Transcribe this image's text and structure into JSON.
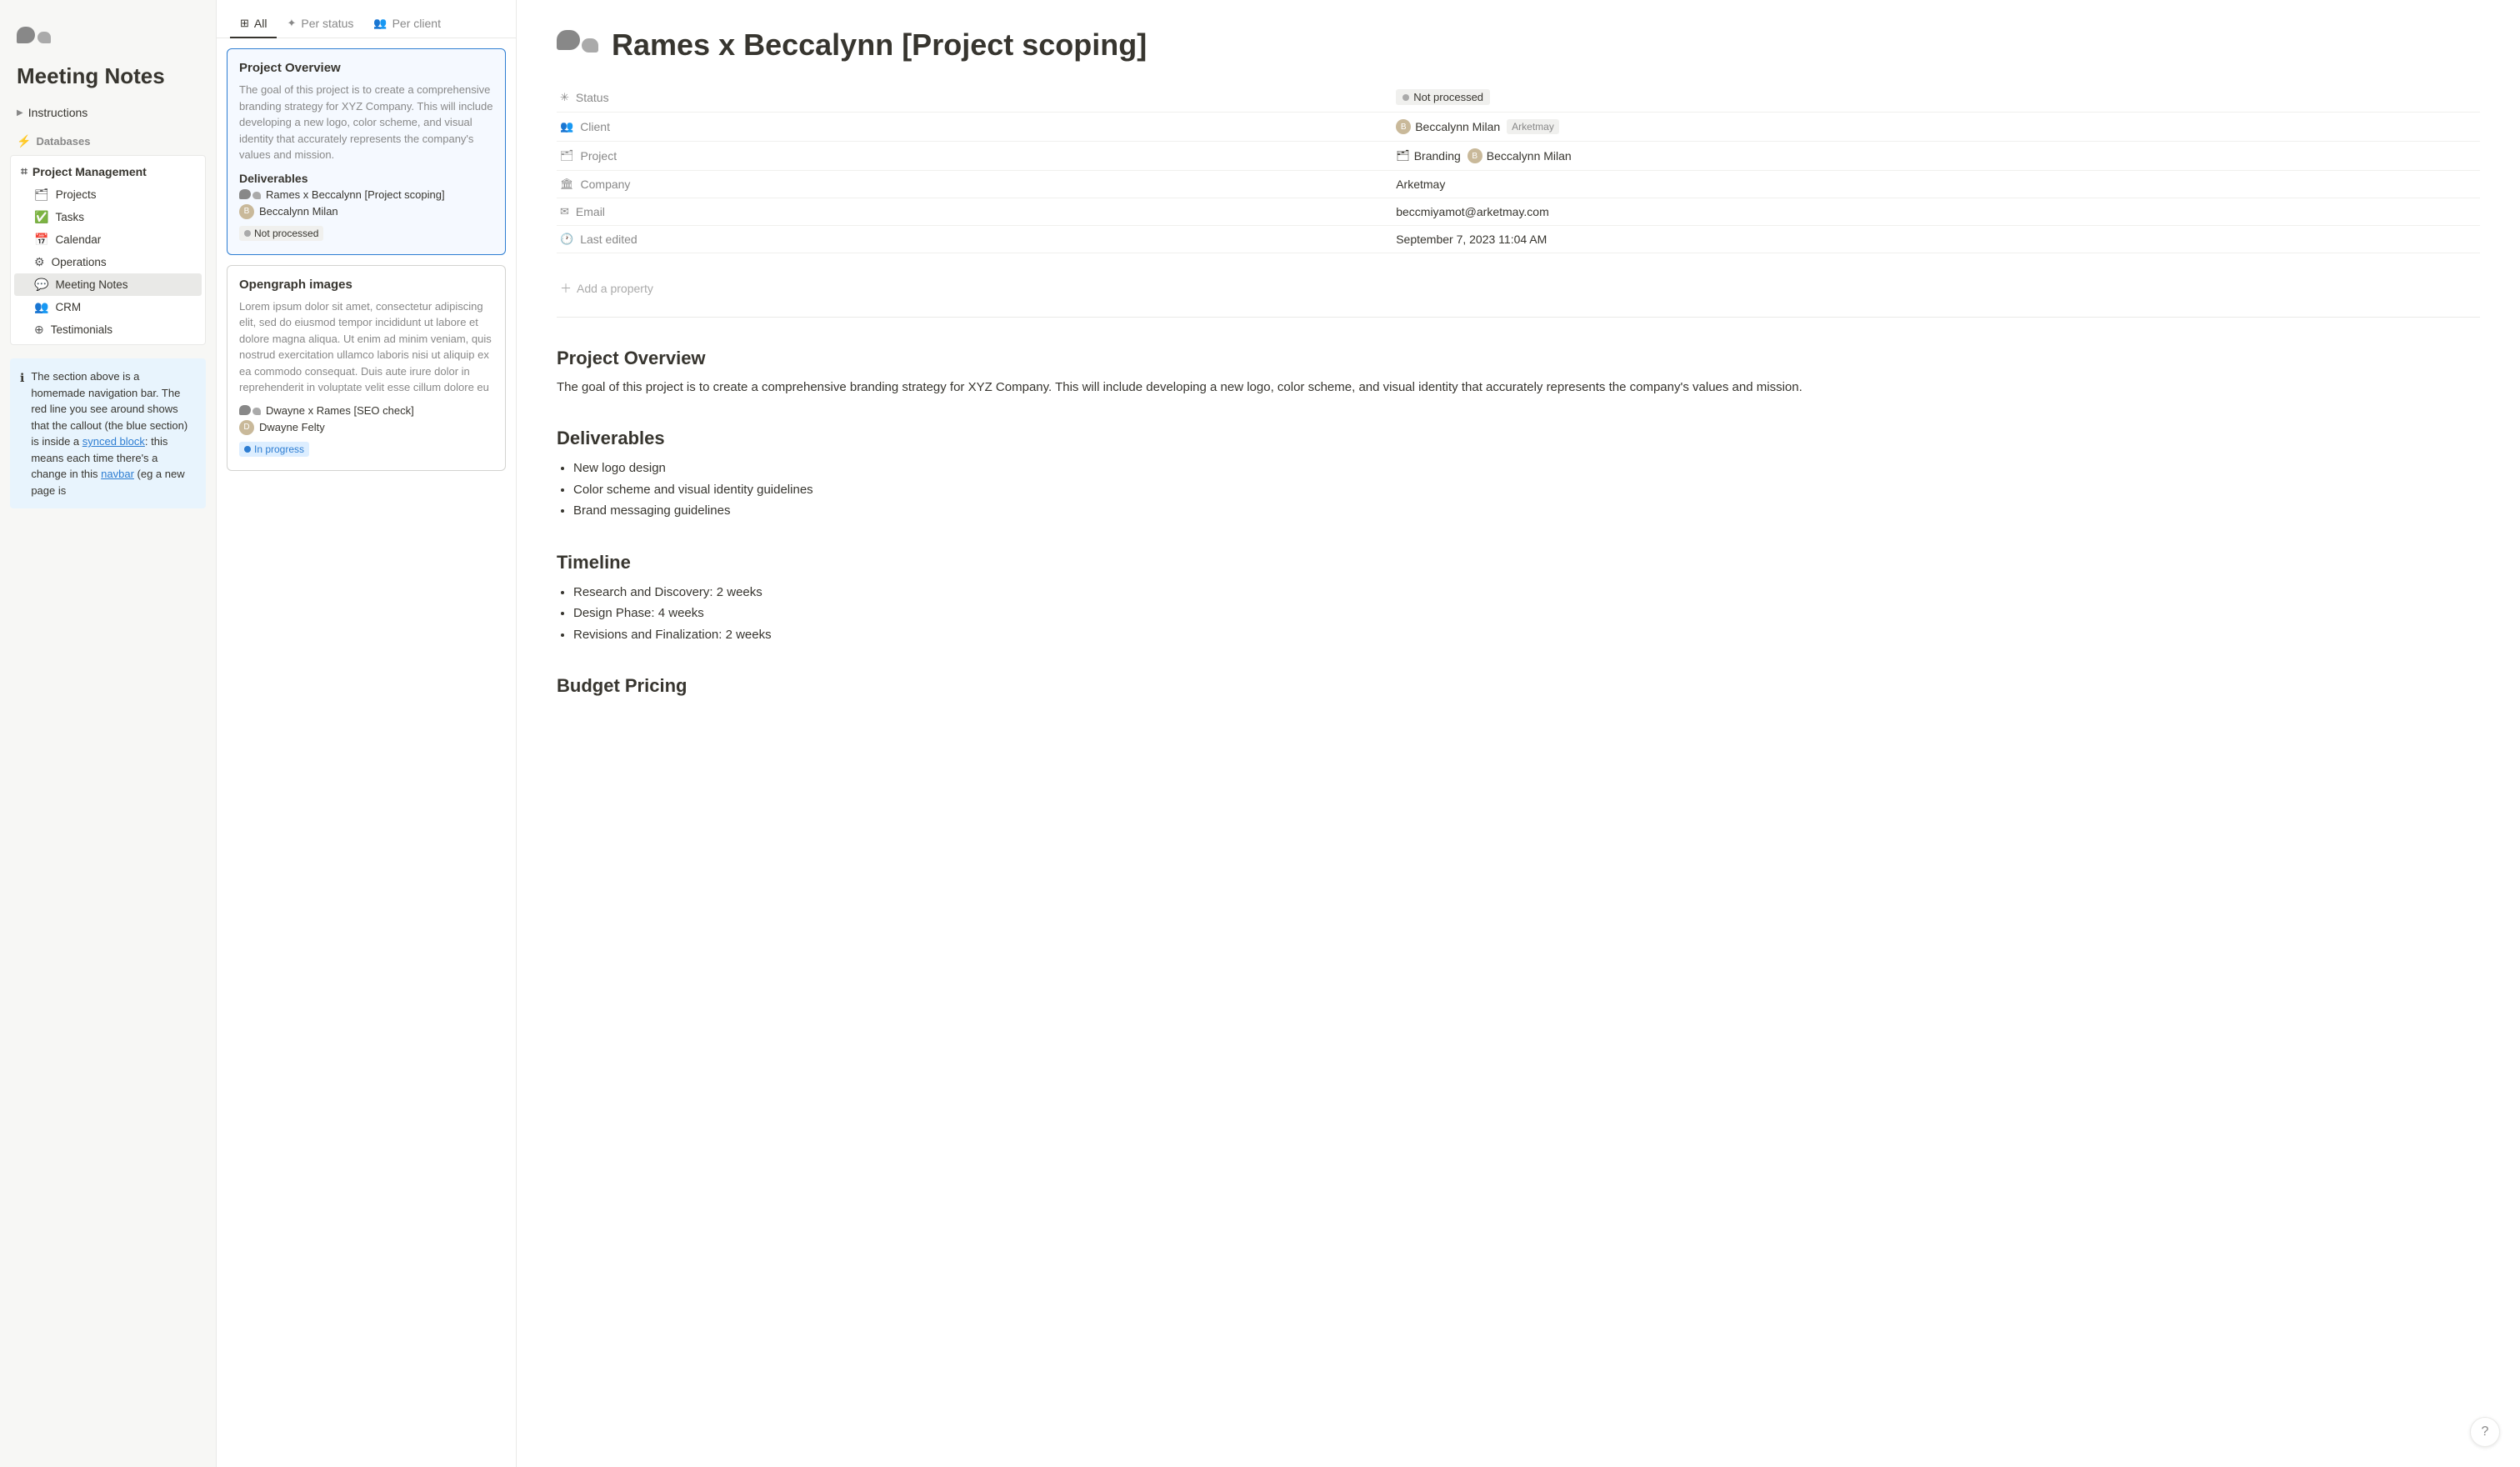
{
  "sidebar": {
    "title": "Meeting Notes",
    "instructions_label": "Instructions",
    "databases_label": "Databases",
    "nav_group": {
      "title": "Project Management",
      "icon": "⌗",
      "items": [
        {
          "id": "projects",
          "label": "Projects",
          "icon": "🗂"
        },
        {
          "id": "tasks",
          "label": "Tasks",
          "icon": "✅"
        },
        {
          "id": "calendar",
          "label": "Calendar",
          "icon": "📅"
        },
        {
          "id": "operations",
          "label": "Operations",
          "icon": "⚙"
        },
        {
          "id": "meeting-notes",
          "label": "Meeting Notes",
          "icon": "💬"
        },
        {
          "id": "crm",
          "label": "CRM",
          "icon": "👥"
        },
        {
          "id": "testimonials",
          "label": "Testimonials",
          "icon": "⊕"
        }
      ]
    },
    "callout_text": "The section above is a homemade navigation bar. The red line you see around shows that the callout (the blue section) is inside a synced block: this means each time there's a change in this navbar (eg a new page is",
    "callout_link": "synced block",
    "callout_navbar": "navbar"
  },
  "middle": {
    "tabs": [
      {
        "id": "all",
        "label": "All",
        "icon": "⊞",
        "active": true
      },
      {
        "id": "per-status",
        "label": "Per status",
        "icon": "✦"
      },
      {
        "id": "per-client",
        "label": "Per client",
        "icon": "👥"
      }
    ],
    "cards": [
      {
        "id": "card1",
        "selected": true,
        "title": "Project Overview",
        "body": "The goal of this project is to create a comprehensive branding strategy for XYZ Company. This will include developing a new logo, color scheme, and visual identity that accurately represents the company's values and mission.",
        "section": "Deliverables",
        "meeting_title": "Rames x Beccalynn [Project scoping]",
        "person": "Beccalynn Milan",
        "status": "Not processed",
        "status_color": "#aaa"
      },
      {
        "id": "card2",
        "selected": false,
        "title": "Opengraph images",
        "body": "Lorem ipsum dolor sit amet, consectetur adipiscing elit, sed do eiusmod tempor incididunt ut labore et dolore magna aliqua. Ut enim ad minim veniam, quis nostrud exercitation ullamco laboris nisi ut aliquip ex ea commodo consequat. Duis aute irure dolor in reprehenderit in voluptate velit esse cillum dolore eu",
        "meeting_title": "Dwayne x Rames [SEO check]",
        "person": "Dwayne Felty",
        "status": "In progress",
        "status_color": "#2d7dd2"
      }
    ]
  },
  "detail": {
    "icon": "💬",
    "title": "Rames x Beccalynn [Project scoping]",
    "properties": [
      {
        "id": "status",
        "icon": "✳",
        "label": "Status",
        "value": "Not processed",
        "type": "badge"
      },
      {
        "id": "client",
        "icon": "👥",
        "label": "Client",
        "value": "Beccalynn Milan",
        "tag": "Arketmay",
        "type": "person"
      },
      {
        "id": "project",
        "icon": "🗂",
        "label": "Project",
        "value": "Branding",
        "person2": "Beccalynn Milan",
        "type": "project"
      },
      {
        "id": "company",
        "icon": "🏛",
        "label": "Company",
        "value": "Arketmay",
        "type": "text"
      },
      {
        "id": "email",
        "icon": "✉",
        "label": "Email",
        "value": "beccmiyamot@arketmay.com",
        "type": "text"
      },
      {
        "id": "last-edited",
        "icon": "🕐",
        "label": "Last edited",
        "value": "September 7, 2023 11:04 AM",
        "type": "text"
      }
    ],
    "add_property_label": "Add a property",
    "overview_title": "Project Overview",
    "overview_body": "The goal of this project is to create a comprehensive branding strategy for XYZ Company. This will include developing a new logo, color scheme, and visual identity that accurately represents the company's values and mission.",
    "deliverables_title": "Deliverables",
    "deliverables": [
      "New logo design",
      "Color scheme and visual identity guidelines",
      "Brand messaging guidelines"
    ],
    "timeline_title": "Timeline",
    "timeline_items": [
      "Research and Discovery: 2 weeks",
      "Design Phase: 4 weeks",
      "Revisions and Finalization: 2 weeks"
    ],
    "budget_title": "Budget Pricing"
  },
  "help_btn": "?"
}
